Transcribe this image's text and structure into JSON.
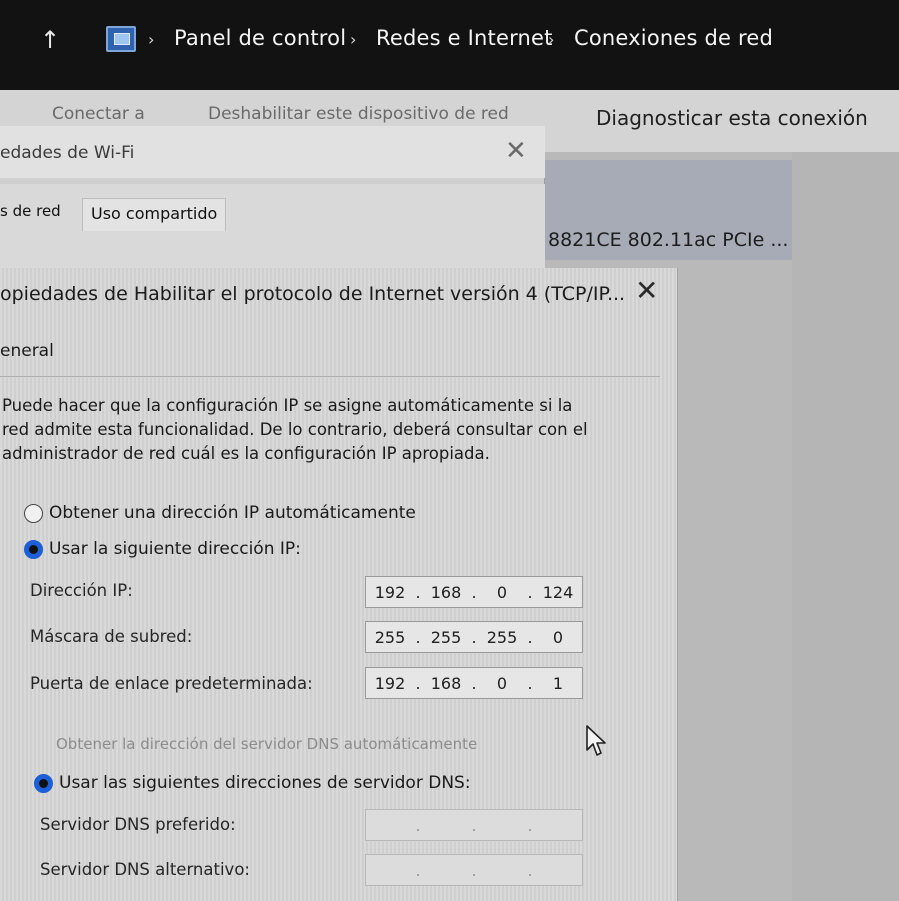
{
  "breadcrumb": {
    "items": [
      "Panel de control",
      "Redes e Internet",
      "Conexiones de red"
    ],
    "separator": "›"
  },
  "toolbar": {
    "connect_label": "Conectar a",
    "disable_label": "Deshabilitar este dispositivo de red",
    "diagnose_label": "Diagnosticar esta conexión"
  },
  "adapter": {
    "description": "8821CE 802.11ac PCIe ..."
  },
  "wifi_dialog": {
    "title": "edades de Wi-Fi",
    "close_glyph": "✕",
    "tab_network": "s de red",
    "tab_sharing": "Uso compartido"
  },
  "tcp_dialog": {
    "title": "opiedades de Habilitar el protocolo de Internet versión 4 (TCP/IP...",
    "close_glyph": "✕",
    "tab_general": "eneral",
    "description_lines": [
      "Puede hacer que la configuración IP se asigne automáticamente si la",
      "red admite esta funcionalidad. De lo contrario, deberá consultar con el",
      "administrador de red cuál es la configuración IP apropiada."
    ],
    "ip_auto_label": "Obtener una dirección IP automáticamente",
    "ip_manual_label": "Usar la siguiente dirección IP:",
    "ip_address_label": "Dirección IP:",
    "ip_address": [
      "192",
      "168",
      "0",
      "124"
    ],
    "subnet_label": "Máscara de subred:",
    "subnet": [
      "255",
      "255",
      "255",
      "0"
    ],
    "gateway_label": "Puerta de enlace predeterminada:",
    "gateway": [
      "192",
      "168",
      "0",
      "1"
    ],
    "dns_auto_label": "Obtener la dirección del servidor DNS automáticamente",
    "dns_manual_label": "Usar las siguientes direcciones de servidor DNS:",
    "dns_preferred_label": "Servidor DNS preferido:",
    "dns_preferred": [
      "",
      "",
      "",
      ""
    ],
    "dns_alternate_label": "Servidor DNS alternativo:",
    "dns_alternate": [
      "",
      "",
      "",
      ""
    ],
    "ip_mode": "manual",
    "dns_mode": "manual"
  },
  "colors": {
    "selected_radio": "#1c5fd6",
    "title_bar": "#121212"
  }
}
